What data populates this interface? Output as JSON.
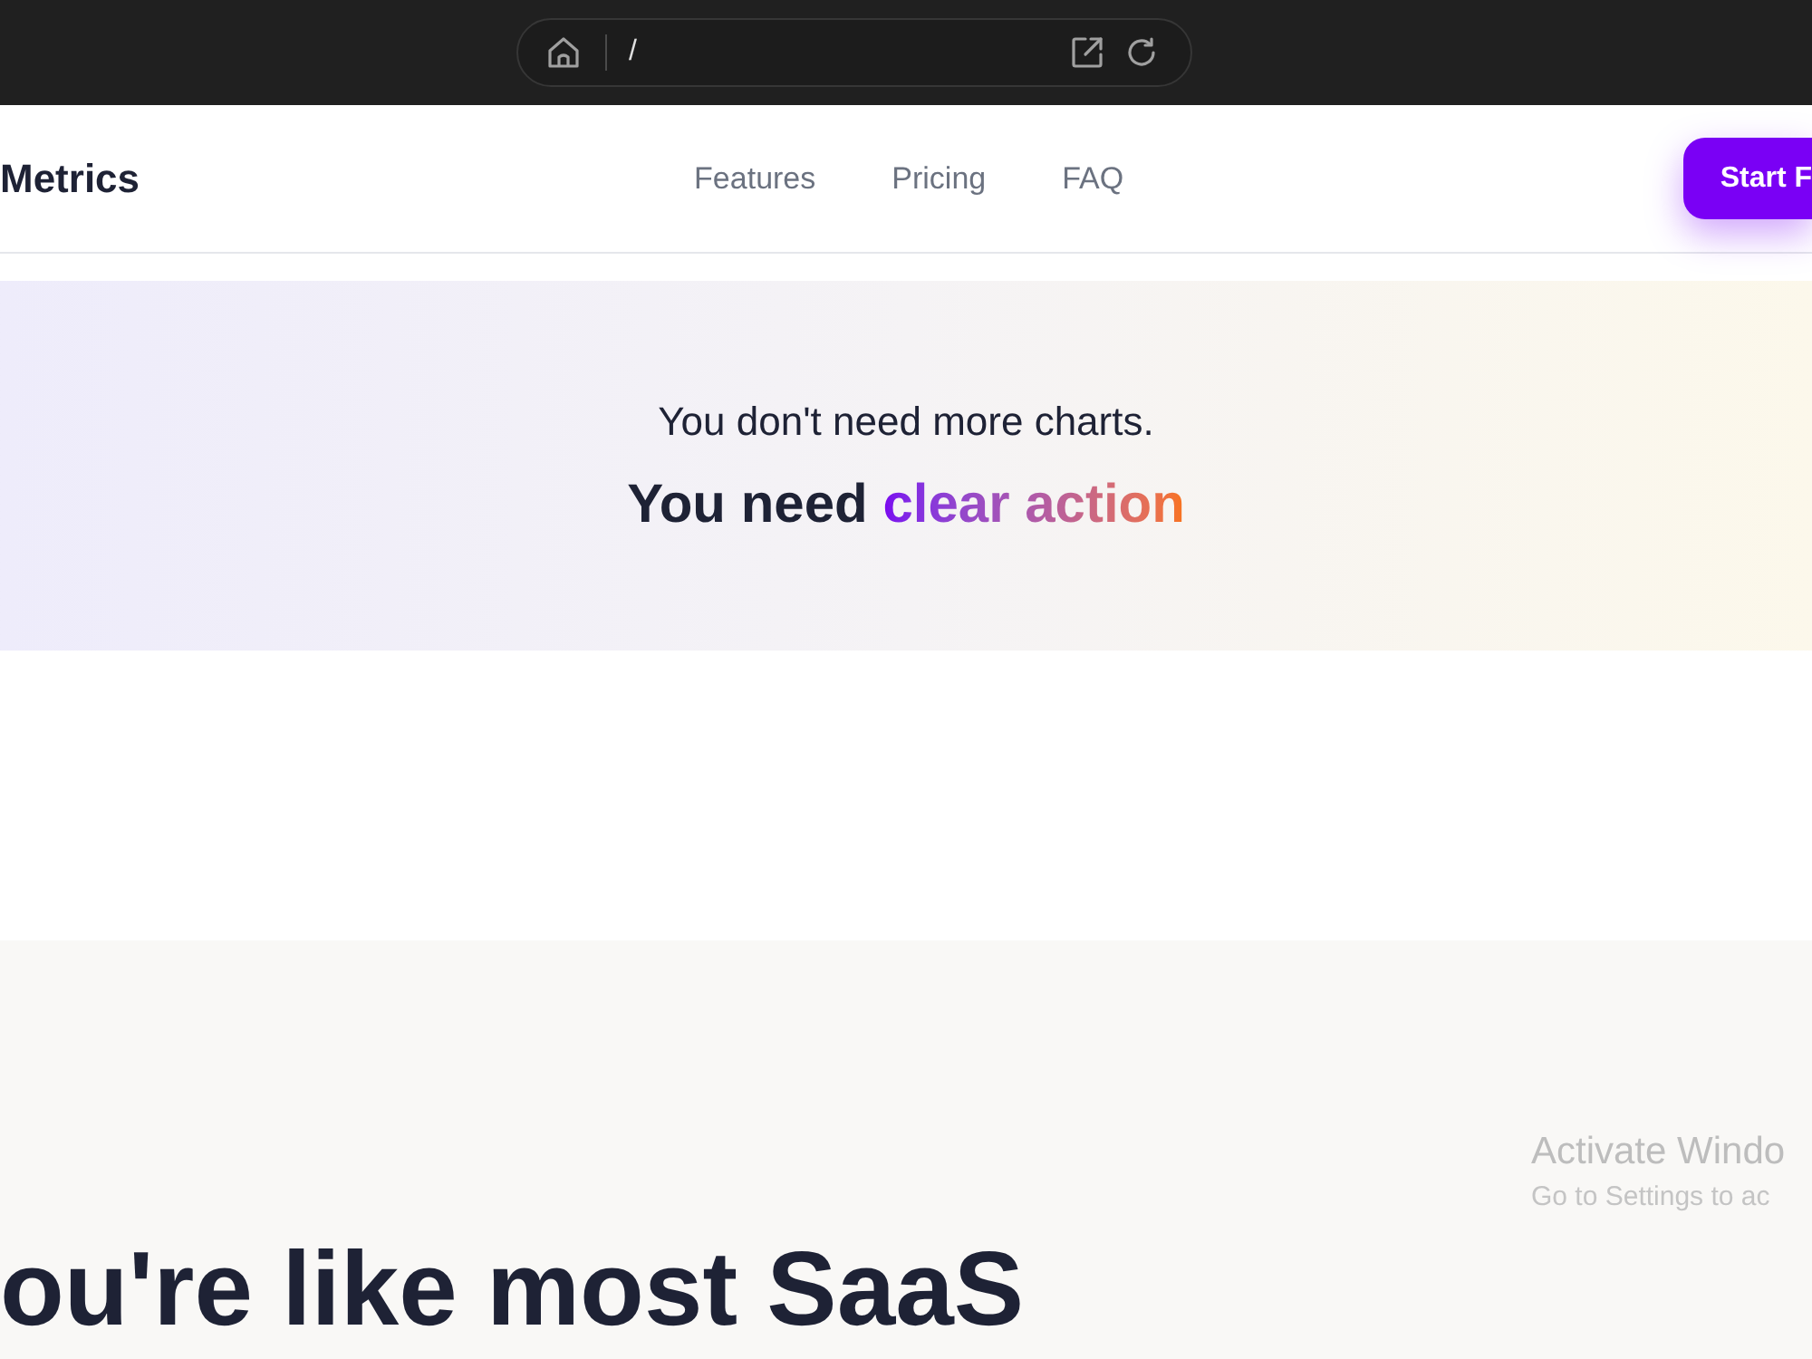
{
  "browser": {
    "address": "/"
  },
  "nav": {
    "brand": "Metrics",
    "links": [
      "Features",
      "Pricing",
      "FAQ"
    ],
    "cta": "Start F"
  },
  "banner": {
    "subtitle": "You don't need more charts.",
    "headline": {
      "lead": "You need",
      "highlight": "clear action"
    }
  },
  "section": {
    "heading": "ou're like most SaaS"
  },
  "os_watermark": {
    "title": "Activate Windo",
    "subtitle": "Go to Settings to ac"
  }
}
